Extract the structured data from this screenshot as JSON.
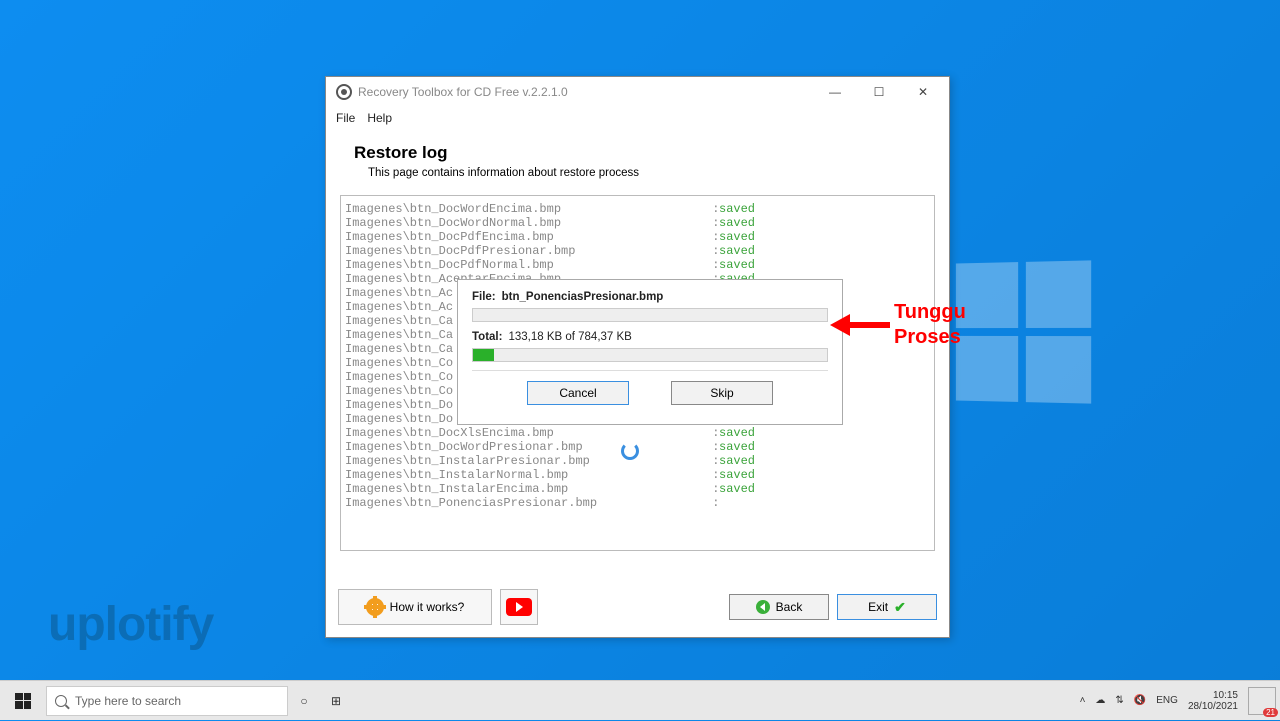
{
  "window": {
    "title": "Recovery Toolbox for CD Free v.2.2.1.0",
    "menu": {
      "file": "File",
      "help": "Help"
    },
    "controls": {
      "minimize": "—",
      "maximize": "☐",
      "close": "✕"
    }
  },
  "header": {
    "title": "Restore log",
    "subtitle": "This page contains information about restore process"
  },
  "log": {
    "saved_label": "saved",
    "sep": ":",
    "lines": [
      {
        "path": "Imagenes\\btn_DocWordEncima.bmp",
        "status": "saved"
      },
      {
        "path": "Imagenes\\btn_DocWordNormal.bmp",
        "status": "saved"
      },
      {
        "path": "Imagenes\\btn_DocPdfEncima.bmp",
        "status": "saved"
      },
      {
        "path": "Imagenes\\btn_DocPdfPresionar.bmp",
        "status": "saved"
      },
      {
        "path": "Imagenes\\btn_DocPdfNormal.bmp",
        "status": "saved"
      },
      {
        "path": "Imagenes\\btn_AceptarEncima.bmp",
        "status": "saved"
      },
      {
        "path": "Imagenes\\btn_Ac",
        "status": ""
      },
      {
        "path": "Imagenes\\btn_Ac",
        "status": ""
      },
      {
        "path": "Imagenes\\btn_Ca",
        "status": ""
      },
      {
        "path": "Imagenes\\btn_Ca",
        "status": ""
      },
      {
        "path": "Imagenes\\btn_Ca",
        "status": ""
      },
      {
        "path": "Imagenes\\btn_Co",
        "status": ""
      },
      {
        "path": "Imagenes\\btn_Co",
        "status": ""
      },
      {
        "path": "Imagenes\\btn_Co",
        "status": ""
      },
      {
        "path": "Imagenes\\btn_Do",
        "status": ""
      },
      {
        "path": "Imagenes\\btn_Do",
        "status": ""
      },
      {
        "path": "Imagenes\\btn_DocXlsEncima.bmp",
        "status": "saved"
      },
      {
        "path": "Imagenes\\btn_DocWordPresionar.bmp",
        "status": "saved"
      },
      {
        "path": "Imagenes\\btn_InstalarPresionar.bmp",
        "status": "saved"
      },
      {
        "path": "Imagenes\\btn_InstalarNormal.bmp",
        "status": "saved"
      },
      {
        "path": "Imagenes\\btn_InstalarEncima.bmp",
        "status": "saved"
      },
      {
        "path": "Imagenes\\btn_PonenciasPresionar.bmp",
        "status": ""
      }
    ]
  },
  "progress": {
    "file_label": "File:",
    "file_name": "btn_PonenciasPresionar.bmp",
    "file_pct": 0,
    "total_label": "Total:",
    "total_text": "133,18 KB of 784,37 KB",
    "total_pct": 6,
    "cancel": "Cancel",
    "skip": "Skip"
  },
  "bottom": {
    "how": "How it works?",
    "back": "Back",
    "exit": "Exit"
  },
  "annotation": {
    "line1": "Tunggu",
    "line2": "Proses"
  },
  "taskbar": {
    "search_placeholder": "Type here to search",
    "lang": "ENG",
    "time": "10:15",
    "date": "28/10/2021",
    "notif_count": "21"
  },
  "watermark": "uplotify"
}
